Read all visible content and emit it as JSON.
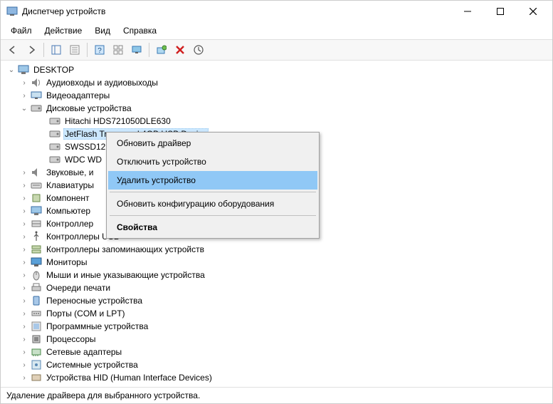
{
  "window": {
    "title": "Диспетчер устройств"
  },
  "menu": {
    "file": "Файл",
    "action": "Действие",
    "view": "Вид",
    "help": "Справка"
  },
  "tree": {
    "root": "DESKTOP",
    "cat_audio": "Аудиовходы и аудиовыходы",
    "cat_video": "Видеоадаптеры",
    "cat_disks": "Дисковые устройства",
    "disk0": "Hitachi HDS721050DLE630",
    "disk1": "JetFlash Transcend 4GB USB Device",
    "disk2": "SWSSD12",
    "disk3": "WDC WD",
    "cat_sound": "Звуковые, и",
    "cat_keyboard": "Клавиатуры",
    "cat_components": "Компонент",
    "cat_computer": "Компьютер",
    "cat_controllers": "Контроллер",
    "cat_usb": "Контроллеры USB",
    "cat_storage_ctrl": "Контроллеры запоминающих устройств",
    "cat_monitors": "Мониторы",
    "cat_mice": "Мыши и иные указывающие устройства",
    "cat_print_queues": "Очереди печати",
    "cat_portable": "Переносные устройства",
    "cat_ports": "Порты (COM и LPT)",
    "cat_software_dev": "Программные устройства",
    "cat_cpu": "Процессоры",
    "cat_network": "Сетевые адаптеры",
    "cat_system": "Системные устройства",
    "cat_hid": "Устройства HID (Human Interface Devices)"
  },
  "context_menu": {
    "update_driver": "Обновить драйвер",
    "disable": "Отключить устройство",
    "uninstall": "Удалить устройство",
    "scan": "Обновить конфигурацию оборудования",
    "properties": "Свойства"
  },
  "status": "Удаление драйвера для выбранного устройства."
}
